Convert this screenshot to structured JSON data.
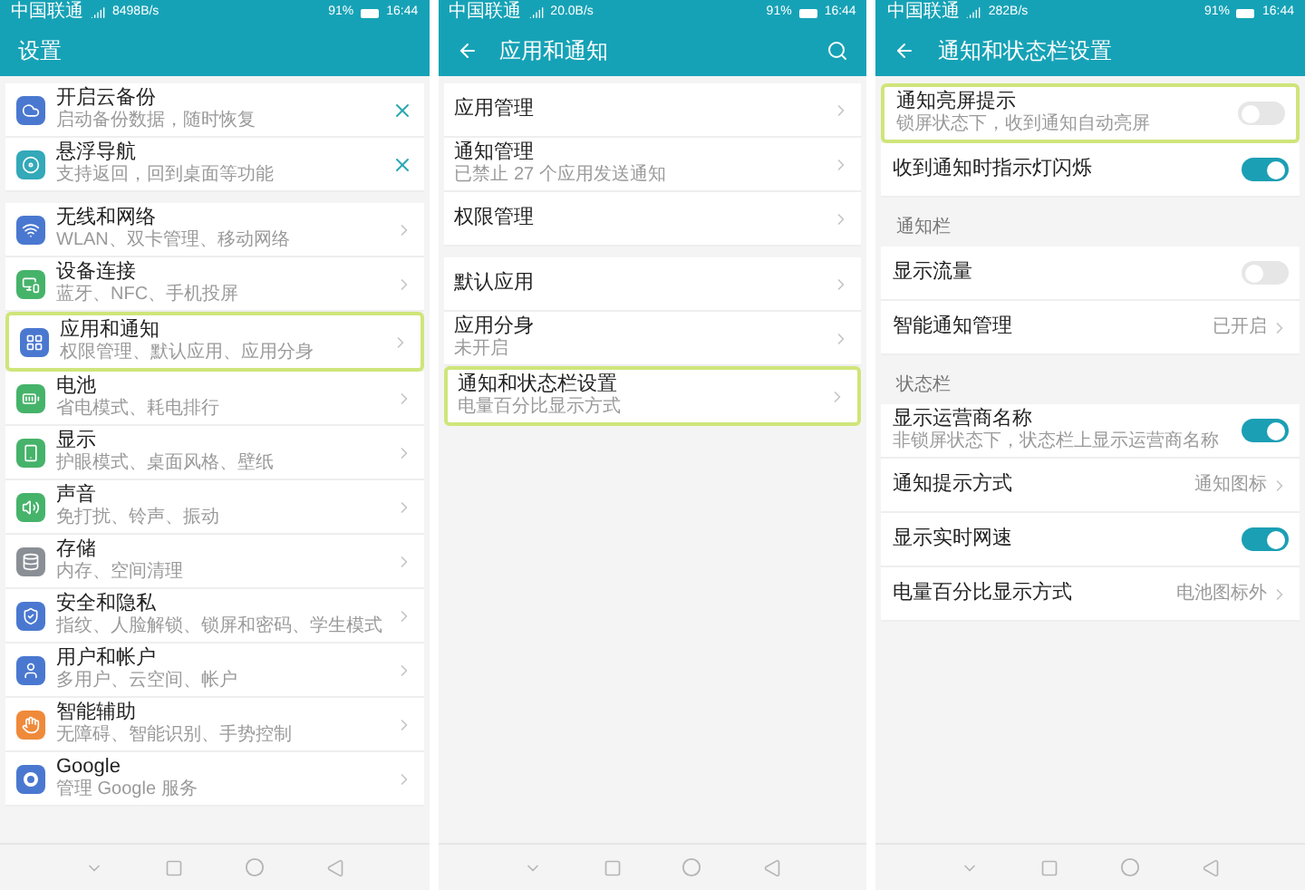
{
  "screens": [
    {
      "status_bar": {
        "carrier": "中国联通",
        "speed": "8498B/s",
        "battery": "91%",
        "time": "16:44"
      },
      "header": {
        "title": "设置",
        "back": false,
        "search": false
      },
      "sections": [
        {
          "items": [
            {
              "title": "开启云备份",
              "subtitle": "启动备份数据，随时恢复",
              "color": "#4a78d0",
              "kind": "close",
              "highlighted": false
            },
            {
              "title": "悬浮导航",
              "subtitle": "支持返回，回到桌面等功能",
              "color": "#33a9b9",
              "kind": "close",
              "highlighted": false
            }
          ]
        },
        {
          "items": [
            {
              "title": "无线和网络",
              "subtitle": "WLAN、双卡管理、移动网络",
              "color": "#4a78d0",
              "kind": "chevron",
              "highlighted": false
            },
            {
              "title": "设备连接",
              "subtitle": "蓝牙、NFC、手机投屏",
              "color": "#46b36a",
              "kind": "chevron",
              "highlighted": false
            },
            {
              "title": "应用和通知",
              "subtitle": "权限管理、默认应用、应用分身",
              "color": "#4a78d0",
              "kind": "chevron",
              "highlighted": true
            },
            {
              "title": "电池",
              "subtitle": "省电模式、耗电排行",
              "color": "#46b36a",
              "kind": "chevron",
              "highlighted": false
            },
            {
              "title": "显示",
              "subtitle": "护眼模式、桌面风格、壁纸",
              "color": "#46b36a",
              "kind": "chevron",
              "highlighted": false
            },
            {
              "title": "声音",
              "subtitle": "免打扰、铃声、振动",
              "color": "#46b36a",
              "kind": "chevron",
              "highlighted": false
            },
            {
              "title": "存储",
              "subtitle": "内存、空间清理",
              "color": "#8a8f96",
              "kind": "chevron",
              "highlighted": false
            },
            {
              "title": "安全和隐私",
              "subtitle": "指纹、人脸解锁、锁屏和密码、学生模式",
              "color": "#4a78d0",
              "kind": "chevron",
              "highlighted": false
            },
            {
              "title": "用户和帐户",
              "subtitle": "多用户、云空间、帐户",
              "color": "#4a78d0",
              "kind": "chevron",
              "highlighted": false
            },
            {
              "title": "智能辅助",
              "subtitle": "无障碍、智能识别、手势控制",
              "color": "#ef8a3a",
              "kind": "chevron",
              "highlighted": false
            },
            {
              "title": "Google",
              "subtitle": "管理 Google 服务",
              "color": "#4a78d0",
              "kind": "chevron",
              "highlighted": false
            }
          ]
        }
      ]
    },
    {
      "status_bar": {
        "carrier": "中国联通",
        "speed": "20.0B/s",
        "battery": "91%",
        "time": "16:44"
      },
      "header": {
        "title": "应用和通知",
        "back": true,
        "search": true
      },
      "sections": [
        {
          "items": [
            {
              "title": "应用管理",
              "kind": "chevron",
              "highlighted": false
            },
            {
              "title": "通知管理",
              "subtitle": "已禁止 27 个应用发送通知",
              "kind": "chevron",
              "highlighted": false
            },
            {
              "title": "权限管理",
              "kind": "chevron",
              "highlighted": false
            }
          ]
        },
        {
          "items": [
            {
              "title": "默认应用",
              "kind": "chevron",
              "highlighted": false
            },
            {
              "title": "应用分身",
              "subtitle": "未开启",
              "kind": "chevron",
              "highlighted": false
            },
            {
              "title": "通知和状态栏设置",
              "subtitle": "电量百分比显示方式",
              "kind": "chevron",
              "highlighted": true
            }
          ]
        }
      ]
    },
    {
      "status_bar": {
        "carrier": "中国联通",
        "speed": "282B/s",
        "battery": "91%",
        "time": "16:44"
      },
      "header": {
        "title": "通知和状态栏设置",
        "back": true,
        "search": false
      },
      "sections": [
        {
          "items": [
            {
              "title": "通知亮屏提示",
              "subtitle": "锁屏状态下，收到通知自动亮屏",
              "kind": "toggle",
              "on": false,
              "highlighted": true
            },
            {
              "title": "收到通知时指示灯闪烁",
              "kind": "toggle",
              "on": true,
              "highlighted": false
            }
          ]
        },
        {
          "label": "通知栏",
          "items": [
            {
              "title": "显示流量",
              "kind": "toggle",
              "on": false,
              "highlighted": false
            },
            {
              "title": "智能通知管理",
              "kind": "chevron",
              "value": "已开启",
              "highlighted": false
            }
          ]
        },
        {
          "label": "状态栏",
          "items": [
            {
              "title": "显示运营商名称",
              "subtitle": "非锁屏状态下，状态栏上显示运营商名称",
              "kind": "toggle",
              "on": true,
              "highlighted": false
            },
            {
              "title": "通知提示方式",
              "kind": "chevron",
              "value": "通知图标",
              "highlighted": false
            },
            {
              "title": "显示实时网速",
              "kind": "toggle",
              "on": true,
              "highlighted": false
            },
            {
              "title": "电量百分比显示方式",
              "kind": "chevron",
              "value": "电池图标外",
              "highlighted": false
            }
          ]
        }
      ]
    }
  ]
}
